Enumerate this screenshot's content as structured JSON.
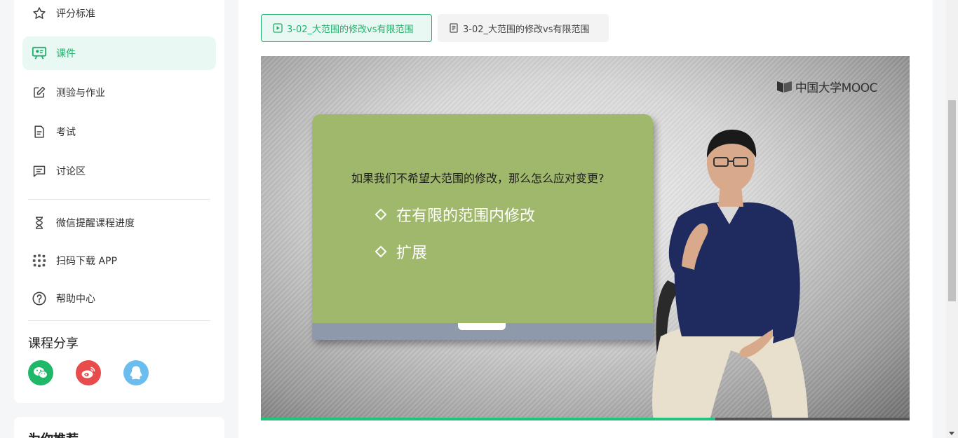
{
  "sidebar": {
    "items": [
      {
        "label": "评分标准",
        "icon": "star-icon"
      },
      {
        "label": "课件",
        "icon": "courseware-icon",
        "active": true
      },
      {
        "label": "测验与作业",
        "icon": "edit-icon"
      },
      {
        "label": "考试",
        "icon": "document-icon"
      },
      {
        "label": "讨论区",
        "icon": "chat-icon"
      }
    ],
    "tools": [
      {
        "label": "微信提醒课程进度",
        "icon": "hourglass-icon"
      },
      {
        "label": "扫码下载 APP",
        "icon": "qr-icon"
      },
      {
        "label": "帮助中心",
        "icon": "help-icon"
      }
    ],
    "share_title": "课程分享",
    "share": [
      {
        "name": "wechat",
        "color": "#1fb868"
      },
      {
        "name": "weibo",
        "color": "#e84b4b"
      },
      {
        "name": "qq",
        "color": "#6bbdf0"
      }
    ],
    "recommend_title": "为你推荐"
  },
  "tabs": [
    {
      "label": "3-02_大范围的修改vs有限范围",
      "type": "video",
      "active": true
    },
    {
      "label": "3-02_大范围的修改vs有限范围",
      "type": "document",
      "active": false
    }
  ],
  "player": {
    "brand": "中国大学MOOC",
    "slide_question": "如果我们不希望大范围的修改，那么怎么应对变更?",
    "bullets": [
      "在有限的范围内修改",
      "扩展"
    ],
    "progress": 0.7
  },
  "colors": {
    "accent": "#21b06c",
    "slide_bg": "#a0b86b"
  }
}
